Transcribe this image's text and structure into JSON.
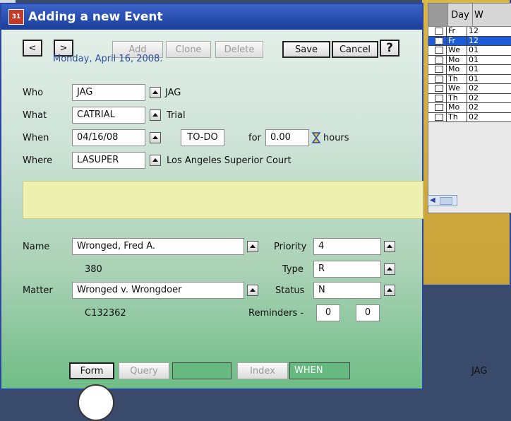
{
  "window": {
    "title": "Adding a new Event",
    "icon_text": "31"
  },
  "toolbar": {
    "back_label": "<",
    "forward_label": ">",
    "add_label": "Add",
    "clone_label": "Clone",
    "delete_label": "Delete",
    "save_label": "Save",
    "cancel_label": "Cancel",
    "help_label": "?"
  },
  "event": {
    "date": "Monday, April 16, 2008.",
    "who": {
      "label": "Who",
      "code": "JAG",
      "description": "JAG"
    },
    "what": {
      "label": "What",
      "code": "CATRIAL",
      "description": "Trial"
    },
    "when": {
      "label": "When",
      "date": "04/16/08",
      "time": "TO-DO",
      "for_label": "for",
      "duration": "0.00",
      "unit": "hours"
    },
    "where": {
      "label": "Where",
      "code": "LASUPER",
      "description": "Los Angeles Superior Court"
    }
  },
  "details": {
    "name_label": "Name",
    "name": "Wronged, Fred A.",
    "name_id": "380",
    "matter_label": "Matter",
    "matter": "Wronged v. Wrongdoer",
    "matter_id": "C132362",
    "priority_label": "Priority",
    "priority": "4",
    "type_label": "Type",
    "type": "R",
    "status_label": "Status",
    "status": "N",
    "reminders_label": "Reminders -",
    "reminder_1": "0",
    "reminder_2": "0"
  },
  "bottombar": {
    "form_label": "Form",
    "query_label": "Query",
    "index_label": "Index",
    "when_label": "WHEN",
    "user": "JAG"
  },
  "grid": {
    "headers": [
      "Day",
      "W"
    ],
    "rows": [
      {
        "day": "Fr",
        "w": "12",
        "selected": false
      },
      {
        "day": "Fr",
        "w": "12",
        "selected": true
      },
      {
        "day": "We",
        "w": "01",
        "selected": false
      },
      {
        "day": "Mo",
        "w": "01",
        "selected": false
      },
      {
        "day": "Mo",
        "w": "01",
        "selected": false
      },
      {
        "day": "Th",
        "w": "01",
        "selected": false
      },
      {
        "day": "We",
        "w": "02",
        "selected": false
      },
      {
        "day": "Th",
        "w": "02",
        "selected": false
      },
      {
        "day": "Mo",
        "w": "02",
        "selected": false
      },
      {
        "day": "Th",
        "w": "02",
        "selected": false
      }
    ]
  },
  "colors": {
    "titlebar": "#1b3d9a",
    "accent_border": "#2b46a0",
    "selected_row": "#1d5bd6",
    "date_text": "#2d4f9c"
  }
}
